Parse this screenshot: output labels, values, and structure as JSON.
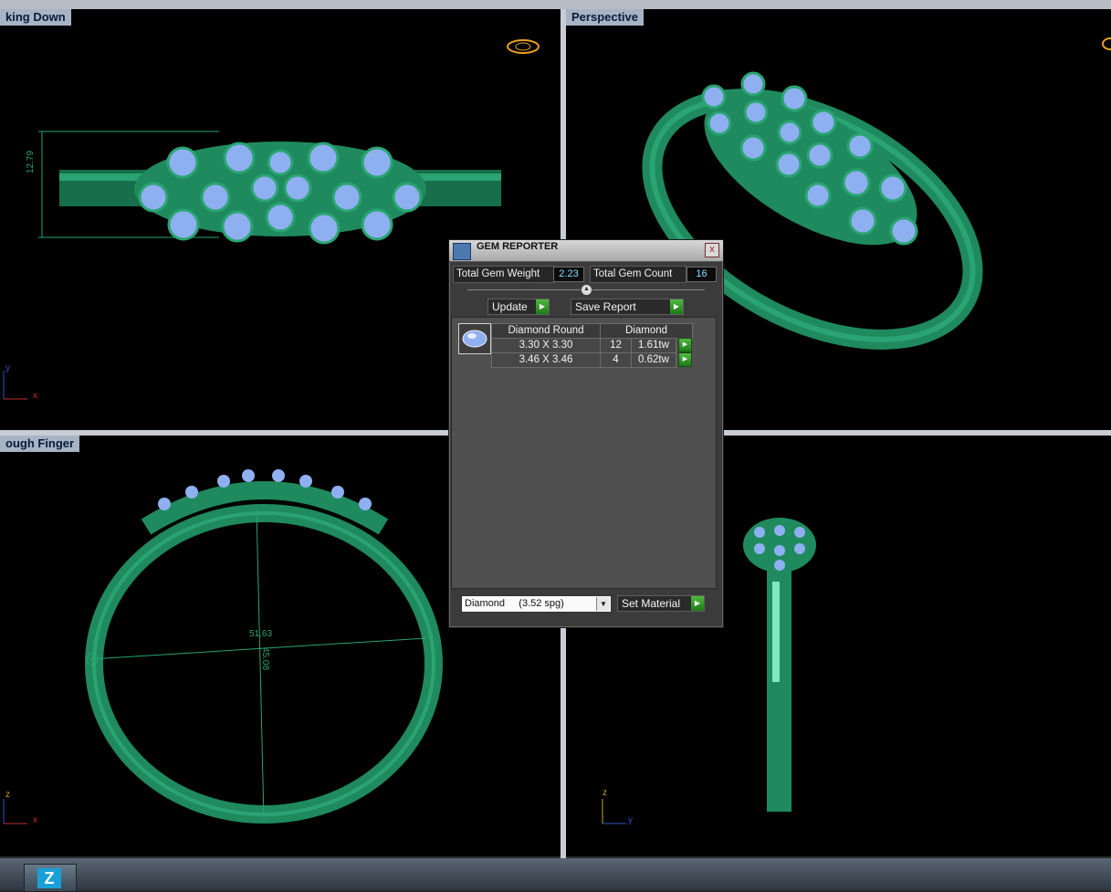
{
  "viewports": {
    "top_left": {
      "label": "king Down",
      "dimension": "12.79"
    },
    "top_right": {
      "label": "Perspective"
    },
    "bottom_left": {
      "label": "ough Finger",
      "dim_horizontal": "51.63",
      "dim_vertical": "45.08"
    },
    "bottom_right": {
      "label": ""
    }
  },
  "axes": {
    "y": "y",
    "x": "x",
    "z": "z"
  },
  "gem_reporter": {
    "title": "GEM REPORTER",
    "close": "x",
    "total_gem_weight_label": "Total Gem Weight",
    "total_gem_weight_value": "2.23",
    "total_gem_count_label": "Total Gem Count",
    "total_gem_count_value": "16",
    "update_label": "Update",
    "save_report_label": "Save Report",
    "table": {
      "header_shape": "Diamond Round",
      "header_material": "Diamond",
      "rows": [
        {
          "size": "3.30 X 3.30",
          "count": "12",
          "weight": "1.61tw"
        },
        {
          "size": "3.46 X 3.46",
          "count": "4",
          "weight": "0.62tw"
        }
      ]
    },
    "material_select": "Diamond     (3.52 spg)",
    "set_material_label": "Set Material"
  },
  "colors": {
    "ring_green": "#1f8a5e",
    "gem_blue": "#8fb0f0",
    "viewport_bg": "#000000",
    "label_bg": "#a8b3c4"
  }
}
